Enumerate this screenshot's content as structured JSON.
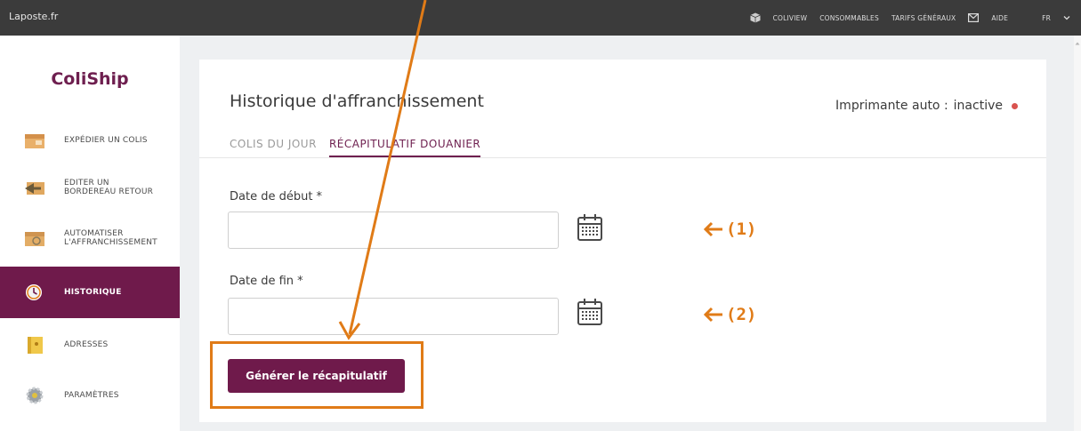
{
  "topbar": {
    "brand": "Laposte.fr",
    "nav": [
      "COLIVIEW",
      "CONSOMMABLES",
      "TARIFS GÉNÉRAUX",
      "AIDE",
      "FR"
    ]
  },
  "sidebar": {
    "logo": "ColiShip",
    "items": [
      {
        "label": "EXPÉDIER UN COLIS",
        "icon": "parcel-icon"
      },
      {
        "label_line1": "EDITER UN",
        "label_line2": "BORDEREAU RETOUR",
        "icon": "return-parcel-icon"
      },
      {
        "label_line1": "AUTOMATISER",
        "label_line2": "L'AFFRANCHISSEMENT",
        "icon": "auto-parcel-icon"
      },
      {
        "label": "HISTORIQUE",
        "icon": "clock-icon",
        "active": true
      },
      {
        "label": "ADRESSES",
        "icon": "address-book-icon"
      },
      {
        "label": "PARAMÈTRES",
        "icon": "settings-gear-icon"
      }
    ]
  },
  "main": {
    "title": "Historique d'affranchissement",
    "printer_label": "Imprimante auto :",
    "printer_status": "inactive",
    "tabs": [
      {
        "label": "COLIS DU JOUR",
        "active": false
      },
      {
        "label": "RÉCAPITULATIF DOUANIER",
        "active": true
      }
    ],
    "start_date": {
      "label": "Date de début *",
      "value": ""
    },
    "end_date": {
      "label": "Date de fin *",
      "value": ""
    },
    "generate_button": "Générer le récapitulatif"
  },
  "annotations": {
    "marker_1": "(1)",
    "marker_2": "(2)",
    "accent_color": "#e07b17"
  },
  "colors": {
    "brand": "#6f1a4b",
    "topbar": "#3b3b3b",
    "status_dot": "#d9534f"
  }
}
